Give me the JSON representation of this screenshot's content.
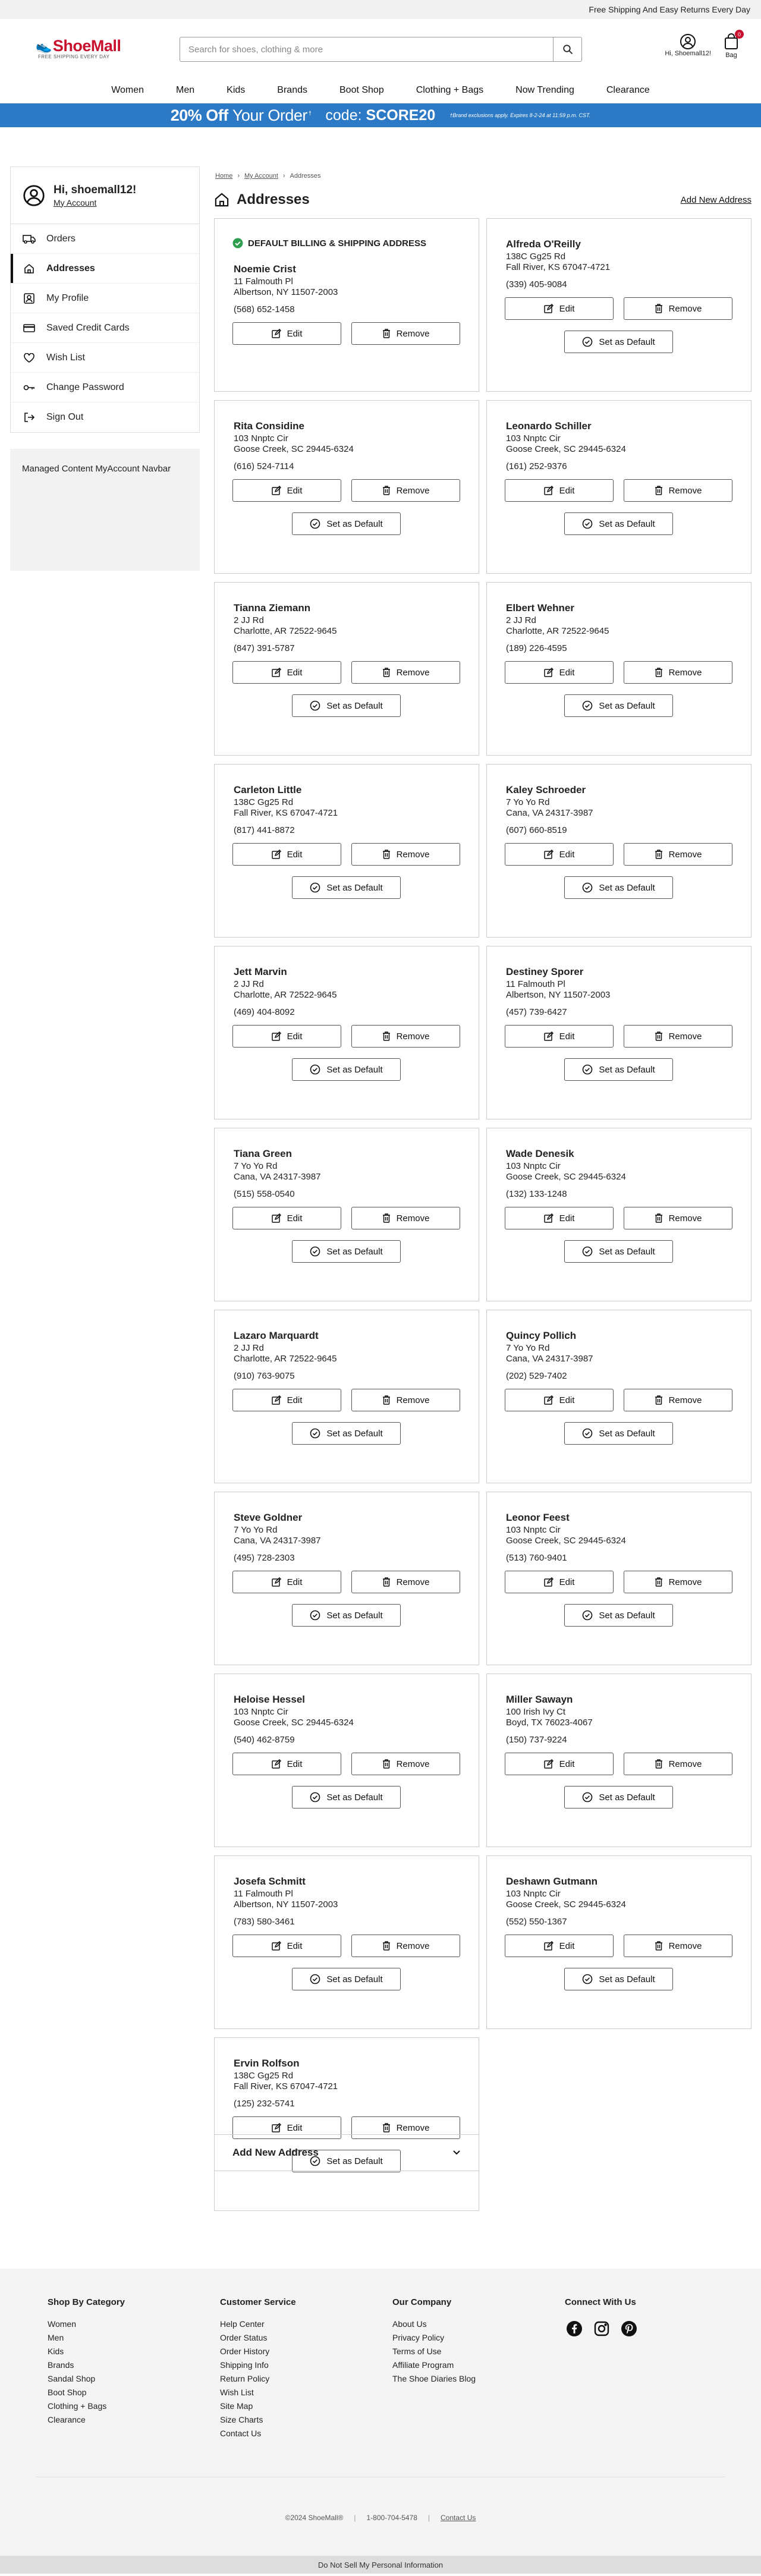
{
  "promo_top": "Free Shipping And Easy Returns Every Day",
  "logo": {
    "word": "ShoeMall",
    "tagline": "FREE SHIPPING EVERY DAY"
  },
  "search": {
    "placeholder": "Search for shoes, clothing & more"
  },
  "header": {
    "account_label": "Hi, Shoemall12!",
    "bag_label": "Bag",
    "bag_count": "0"
  },
  "nav": [
    "Women",
    "Men",
    "Kids",
    "Brands",
    "Boot Shop",
    "Clothing + Bags",
    "Now Trending",
    "Clearance"
  ],
  "banner": {
    "main_bold": "20% Off",
    "main_thin": "Your Order",
    "sup": "†",
    "code_label": "code:",
    "code": "SCORE20",
    "fine": "†Brand exclusions apply. Expires 8-2-24 at 11:59 p.m. CST."
  },
  "sidebar": {
    "greeting": "Hi, shoemall12!",
    "my_account": "My Account",
    "items": [
      {
        "label": "Orders",
        "icon": "truck-icon"
      },
      {
        "label": "Addresses",
        "icon": "home-icon"
      },
      {
        "label": "My Profile",
        "icon": "profile-icon"
      },
      {
        "label": "Saved Credit Cards",
        "icon": "credit-card-icon"
      },
      {
        "label": "Wish List",
        "icon": "heart-icon"
      },
      {
        "label": "Change Password",
        "icon": "key-icon"
      },
      {
        "label": "Sign Out",
        "icon": "sign-out-icon"
      }
    ],
    "managed": "Managed Content MyAccount Navbar"
  },
  "breadcrumb": [
    "Home",
    "My Account",
    "Addresses"
  ],
  "page": {
    "title": "Addresses",
    "add_new_link": "Add New Address"
  },
  "default_label": "DEFAULT BILLING & SHIPPING ADDRESS",
  "buttons": {
    "edit": "Edit",
    "remove": "Remove",
    "set_default": "Set as Default"
  },
  "addresses": [
    {
      "name": "Noemie Crist",
      "street": "11 Falmouth Pl",
      "city": "Albertson, NY 11507-2003",
      "phone": "(568) 652-1458",
      "default": true
    },
    {
      "name": "Alfreda O'Reilly",
      "street": "138C Gg25 Rd",
      "city": "Fall River, KS 67047-4721",
      "phone": "(339) 405-9084",
      "default": false
    },
    {
      "name": "Rita Considine",
      "street": "103 Nnptc Cir",
      "city": "Goose Creek, SC 29445-6324",
      "phone": "(616) 524-7114",
      "default": false
    },
    {
      "name": "Leonardo Schiller",
      "street": "103 Nnptc Cir",
      "city": "Goose Creek, SC 29445-6324",
      "phone": "(161) 252-9376",
      "default": false
    },
    {
      "name": "Tianna Ziemann",
      "street": "2 JJ Rd",
      "city": "Charlotte, AR 72522-9645",
      "phone": "(847) 391-5787",
      "default": false
    },
    {
      "name": "Elbert Wehner",
      "street": "2 JJ Rd",
      "city": "Charlotte, AR 72522-9645",
      "phone": "(189) 226-4595",
      "default": false
    },
    {
      "name": "Carleton Little",
      "street": "138C Gg25 Rd",
      "city": "Fall River, KS 67047-4721",
      "phone": "(817) 441-8872",
      "default": false
    },
    {
      "name": "Kaley Schroeder",
      "street": "7 Yo Yo Rd",
      "city": "Cana, VA 24317-3987",
      "phone": "(607) 660-8519",
      "default": false
    },
    {
      "name": "Jett Marvin",
      "street": "2 JJ Rd",
      "city": "Charlotte, AR 72522-9645",
      "phone": "(469) 404-8092",
      "default": false
    },
    {
      "name": "Destiney Sporer",
      "street": "11 Falmouth Pl",
      "city": "Albertson, NY 11507-2003",
      "phone": "(457) 739-6427",
      "default": false
    },
    {
      "name": "Tiana Green",
      "street": "7 Yo Yo Rd",
      "city": "Cana, VA 24317-3987",
      "phone": "(515) 558-0540",
      "default": false
    },
    {
      "name": "Wade Denesik",
      "street": "103 Nnptc Cir",
      "city": "Goose Creek, SC 29445-6324",
      "phone": "(132) 133-1248",
      "default": false
    },
    {
      "name": "Lazaro Marquardt",
      "street": "2 JJ Rd",
      "city": "Charlotte, AR 72522-9645",
      "phone": "(910) 763-9075",
      "default": false
    },
    {
      "name": "Quincy Pollich",
      "street": "7 Yo Yo Rd",
      "city": "Cana, VA 24317-3987",
      "phone": "(202) 529-7402",
      "default": false
    },
    {
      "name": "Steve Goldner",
      "street": "7 Yo Yo Rd",
      "city": "Cana, VA 24317-3987",
      "phone": "(495) 728-2303",
      "default": false
    },
    {
      "name": "Leonor Feest",
      "street": "103 Nnptc Cir",
      "city": "Goose Creek, SC 29445-6324",
      "phone": "(513) 760-9401",
      "default": false
    },
    {
      "name": "Heloise Hessel",
      "street": "103 Nnptc Cir",
      "city": "Goose Creek, SC 29445-6324",
      "phone": "(540) 462-8759",
      "default": false
    },
    {
      "name": "Miller Sawayn",
      "street": "100 Irish Ivy Ct",
      "city": "Boyd, TX 76023-4067",
      "phone": "(150) 737-9224",
      "default": false
    },
    {
      "name": "Josefa Schmitt",
      "street": "11 Falmouth Pl",
      "city": "Albertson, NY 11507-2003",
      "phone": "(783) 580-3461",
      "default": false
    },
    {
      "name": "Deshawn Gutmann",
      "street": "103 Nnptc Cir",
      "city": "Goose Creek, SC 29445-6324",
      "phone": "(552) 550-1367",
      "default": false
    },
    {
      "name": "Ervin Rolfson",
      "street": "138C Gg25 Rd",
      "city": "Fall River, KS 67047-4721",
      "phone": "(125) 232-5741",
      "default": false
    }
  ],
  "add_new_panel": "Add New Address",
  "footer": {
    "shop": {
      "title": "Shop By Category",
      "links": [
        "Women",
        "Men",
        "Kids",
        "Brands",
        "Sandal Shop",
        "Boot Shop",
        "Clothing + Bags",
        "Clearance"
      ]
    },
    "service": {
      "title": "Customer Service",
      "links": [
        "Help Center",
        "Order Status",
        "Order History",
        "Shipping Info",
        "Return Policy",
        "Wish List",
        "Site Map",
        "Size Charts",
        "Contact Us"
      ]
    },
    "company": {
      "title": "Our Company",
      "links": [
        "About Us",
        "Privacy Policy",
        "Terms of Use",
        "Affiliate Program",
        "The Shoe Diaries Blog"
      ]
    },
    "connect": {
      "title": "Connect With Us"
    },
    "copyright": "©2024 ShoeMall®",
    "phone": "1-800-704-5478",
    "contact": "Contact Us",
    "dnsmpi": "Do Not Sell My Personal Information"
  },
  "colors": {
    "accent": "#c8102e",
    "banner": "#2c79c6",
    "check": "#2e9e4f"
  }
}
